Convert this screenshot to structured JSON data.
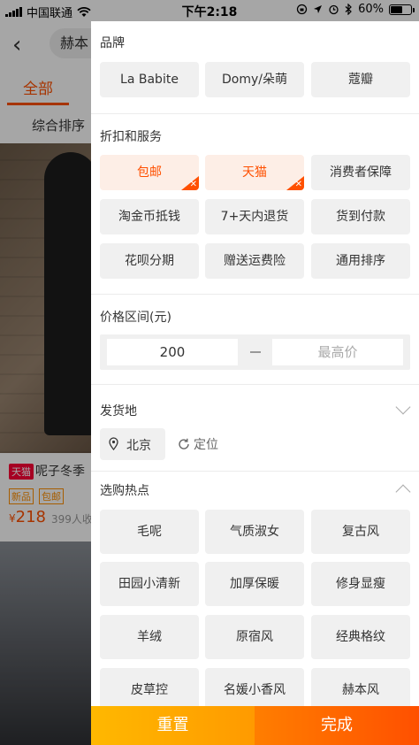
{
  "status_bar": {
    "carrier": "中国联通",
    "time": "下午2:18",
    "battery": "60%",
    "battery_level": 0.6
  },
  "background": {
    "search_text": "赫本",
    "tab_all": "全部",
    "sort": "综合排序",
    "product": {
      "tmall_badge": "天猫",
      "title": "呢子冬季",
      "tag_new": "新品",
      "tag_shipping": "包邮",
      "price_symbol": "¥",
      "price": "218",
      "sales": "399人收"
    }
  },
  "filter": {
    "brand": {
      "title": "品牌",
      "options": [
        {
          "label": "La Babite",
          "selected": false
        },
        {
          "label": "Domy/朵萌",
          "selected": false
        },
        {
          "label": "蔻瓣",
          "selected": false
        }
      ]
    },
    "services": {
      "title": "折扣和服务",
      "options": [
        {
          "label": "包邮",
          "selected": true
        },
        {
          "label": "天猫",
          "selected": true
        },
        {
          "label": "消费者保障",
          "selected": false
        },
        {
          "label": "淘金币抵钱",
          "selected": false
        },
        {
          "label": "7+天内退货",
          "selected": false
        },
        {
          "label": "货到付款",
          "selected": false
        },
        {
          "label": "花呗分期",
          "selected": false
        },
        {
          "label": "赠送运费险",
          "selected": false
        },
        {
          "label": "通用排序",
          "selected": false
        }
      ]
    },
    "price": {
      "title": "价格区间(元)",
      "min_value": "200",
      "max_placeholder": "最高价"
    },
    "ship_from": {
      "title": "发货地",
      "location": "北京",
      "locate_label": "定位"
    },
    "hot": {
      "title": "选购热点",
      "options": [
        {
          "label": "毛呢"
        },
        {
          "label": "气质淑女"
        },
        {
          "label": "复古风"
        },
        {
          "label": "田园小清新"
        },
        {
          "label": "加厚保暖"
        },
        {
          "label": "修身显瘦"
        },
        {
          "label": "羊绒"
        },
        {
          "label": "原宿风"
        },
        {
          "label": "经典格纹"
        },
        {
          "label": "皮草控"
        },
        {
          "label": "名媛小香风"
        },
        {
          "label": "赫本风"
        }
      ]
    },
    "footer": {
      "reset": "重置",
      "done": "完成"
    }
  },
  "colors": {
    "accent": "#ff5000",
    "selected_bg": "#fdeee6",
    "chip_bg": "#f0f0f0",
    "reset_gradient": "#ffb800",
    "done_gradient": "#ff5000"
  }
}
